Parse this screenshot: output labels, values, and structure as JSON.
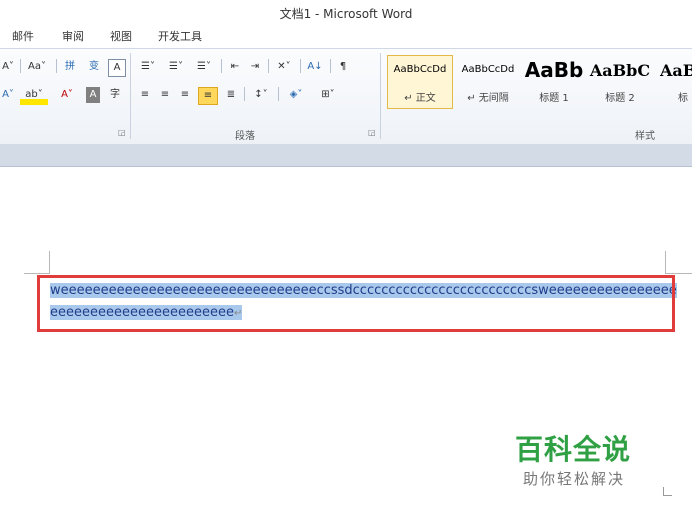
{
  "window": {
    "title": "文档1 - Microsoft Word"
  },
  "menu": {
    "items": [
      "邮件",
      "审阅",
      "视图",
      "开发工具"
    ]
  },
  "ribbon": {
    "font_group": {
      "row1": [
        "A˅",
        "Aa˅",
        "拼",
        "变",
        "A"
      ],
      "row2": [
        "A˅",
        "ab˅",
        "A˅",
        "A",
        "字"
      ]
    },
    "paragraph_group": {
      "label": "段落",
      "row1": [
        "☰˅",
        "☰˅",
        "☰˅",
        "⇤",
        "⇥",
        "✕˅",
        "A↓",
        "¶"
      ],
      "row2": [
        "≡",
        "≡",
        "≡",
        "≡",
        "≣",
        "↕˅",
        "◈˅",
        "⊞˅"
      ]
    },
    "styles_group": {
      "label": "样式",
      "tiles": [
        {
          "preview": "AaBbCcDd",
          "label": "↵ 正文",
          "selected": true
        },
        {
          "preview": "AaBbCcDd",
          "label": "↵ 无间隔",
          "selected": false
        },
        {
          "preview": "AaBb",
          "label": "标题 1",
          "selected": false
        },
        {
          "preview": "AaBbC",
          "label": "标题 2",
          "selected": false
        },
        {
          "preview": "AaB",
          "label": "标",
          "selected": false
        }
      ]
    }
  },
  "document": {
    "line1": "weeeeeeeeeeeeeeeeeeeeeeeeeeeeeeeeccssdcccccccccccccccccccccccccsweeeeeeeeeeeeeeee",
    "line2": "eeeeeeeeeeeeeeeeeeeeeee",
    "paragraph_mark": "↵"
  },
  "watermark": {
    "brand": "百科全说",
    "tagline": "助你轻松解决"
  },
  "colors": {
    "highlight": "#a9c9ec",
    "selection_box": "#e03c3c",
    "brand": "#2fa043"
  }
}
